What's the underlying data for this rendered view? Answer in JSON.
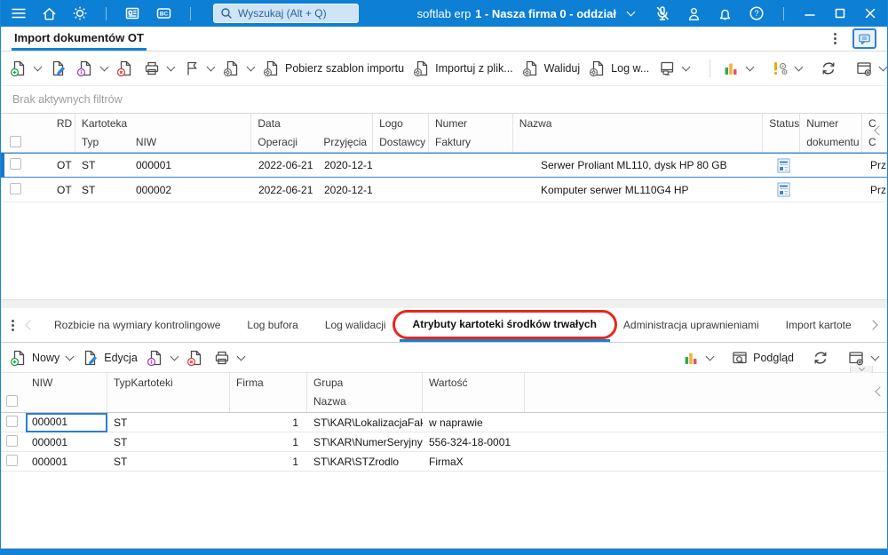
{
  "topbar": {
    "search_placeholder": "Wyszukaj (Alt + Q)",
    "brand": "softlab erp",
    "company": "1 - Nasza firma 0 - oddział"
  },
  "page_tabs": {
    "import_ot": "Import dokumentów OT"
  },
  "toolbar_top": {
    "pobierz_szablon": "Pobierz szablon importu",
    "importuj": "Importuj z plik...",
    "waliduj": "Waliduj",
    "log_w": "Log w..."
  },
  "filter_bar": "Brak aktywnych filtrów",
  "grid_top": {
    "groups": {
      "kartoteka": "Kartoteka",
      "data": "Data"
    },
    "cols": {
      "rd": "RD",
      "typ": "Typ",
      "niw": "NIW",
      "operacji": "Operacji",
      "przyjecia": "Przyjęcia",
      "logo": "Logo",
      "dostawcy": "Dostawcy",
      "numer": "Numer",
      "faktury": "Faktury",
      "nazwa": "Nazwa",
      "status": "Status",
      "numer2": "Numer",
      "dokumentu": "dokumentu",
      "c1": "C",
      "c2": "C"
    },
    "rows": [
      {
        "rd": "OT",
        "typ": "ST",
        "niw": "000001",
        "operacji": "2022-06-21",
        "przyjecia": "2020-12-1",
        "nazwa": "Serwer Proliant ML110, dysk HP 80 GB",
        "edge": "Prz"
      },
      {
        "rd": "OT",
        "typ": "ST",
        "niw": "000002",
        "operacji": "2022-06-21",
        "przyjecia": "2020-12-1",
        "nazwa": "Komputer serwer ML110G4 HP",
        "edge": "Prz"
      }
    ]
  },
  "bottom_tabs": [
    "Rozbicie na wymiary kontrolingowe",
    "Log bufora",
    "Log walidacji",
    "Atrybuty kartoteki środków trwałych",
    "Administracja uprawnieniami",
    "Import kartote"
  ],
  "toolbar_bottom": {
    "nowy": "Nowy",
    "edycja": "Edycja",
    "podglad": "Podgląd"
  },
  "grid_bottom": {
    "cols": {
      "niw": "NIW",
      "typkartoteki": "TypKartoteki",
      "firma": "Firma",
      "grupa": "Grupa",
      "nazwa": "Nazwa",
      "wartosc": "Wartość"
    },
    "rows": [
      {
        "niw": "000001",
        "typ": "ST",
        "firma": "1",
        "grupa": "ST\\KAR\\LokalizacjaFakty",
        "wartosc": "w naprawie"
      },
      {
        "niw": "000001",
        "typ": "ST",
        "firma": "1",
        "grupa": "ST\\KAR\\NumerSeryjny",
        "wartosc": "556-324-18-0001"
      },
      {
        "niw": "000001",
        "typ": "ST",
        "firma": "1",
        "grupa": "ST\\KAR\\STZrodlo",
        "wartosc": "FirmaX"
      }
    ]
  },
  "icons": {
    "menu-icon": "hamburger",
    "home-icon": "house",
    "assistant-icon": "sun",
    "news-icon": "newspaper",
    "bc-icon": "BC badge",
    "search-icon": "magnifier",
    "mic-off-icon": "muted microphone",
    "user-icon": "person",
    "notifications-icon": "bell",
    "help-icon": "question mark",
    "minimize-icon": "dash",
    "maximize-icon": "square",
    "close-icon": "cross",
    "chat-icon": "speech bubble",
    "new-doc-icon": "document + green plus",
    "edit-doc-icon": "document + blue pencil",
    "info-doc-icon": "document + purple info",
    "delete-doc-icon": "document + red cross",
    "print-icon": "printer",
    "flag-icon": "flag",
    "template-doc-icon": "document + gear",
    "export-device-icon": "device",
    "chart-icon": "colored bars",
    "warnings-icon": "exclamation + gears",
    "refresh-icon": "circular arrows",
    "grid-settings-icon": "window + gear",
    "preview-icon": "window + magnifier",
    "status-doc-icon": "blue document"
  },
  "colors": {
    "header_blue": "#0d7fd5",
    "accent_blue": "#1083d6",
    "annotation_red": "#e8271e"
  }
}
